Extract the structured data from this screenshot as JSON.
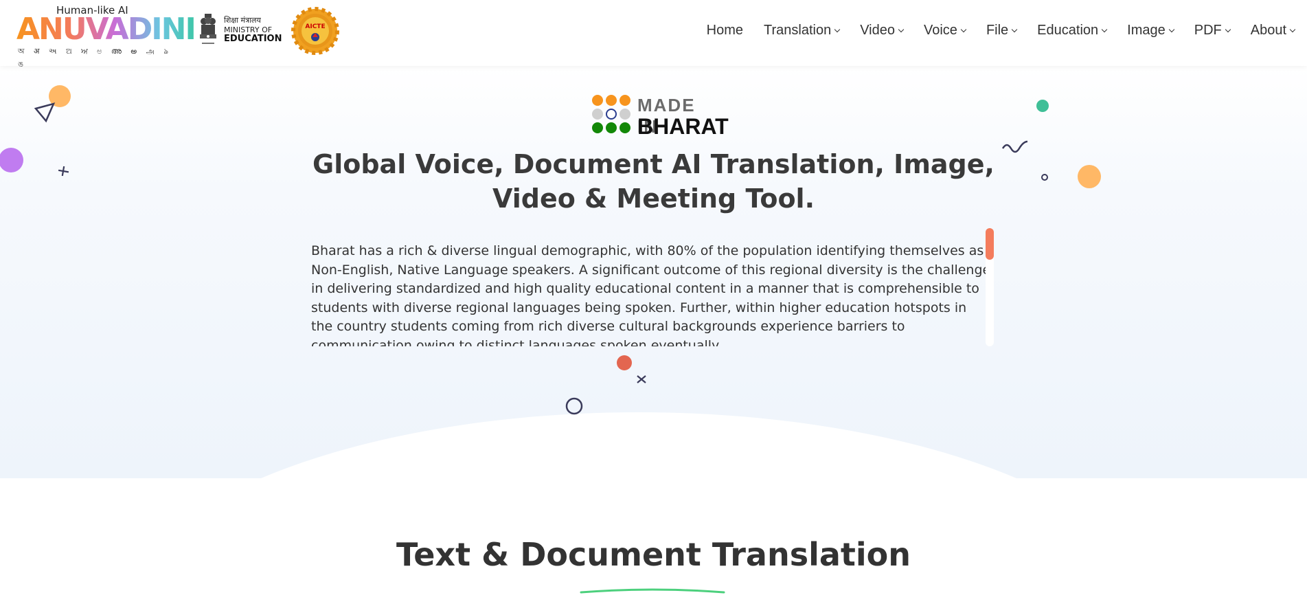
{
  "header": {
    "logo_tagline": "Human-like AI",
    "logo_name": "ANUVADINI",
    "logo_script": "অ अ અ ଅ ਅ ಅ അ అ அ ঌ ঙ",
    "ministry_hindi": "शिक्षा मंत्रालय",
    "ministry_line1": "MINISTRY OF",
    "ministry_line2": "EDUCATION",
    "aicte_label": "AICTE"
  },
  "nav": {
    "items": [
      {
        "label": "Home",
        "dropdown": false
      },
      {
        "label": "Translation",
        "dropdown": true
      },
      {
        "label": "Video",
        "dropdown": true
      },
      {
        "label": "Voice",
        "dropdown": true
      },
      {
        "label": "File",
        "dropdown": true
      },
      {
        "label": "Education",
        "dropdown": true
      },
      {
        "label": "Image",
        "dropdown": true
      },
      {
        "label": "PDF",
        "dropdown": true
      },
      {
        "label": "About",
        "dropdown": true
      }
    ]
  },
  "hero": {
    "badge_line1": "MADE IN",
    "badge_line2": "BHARAT",
    "title": "Global Voice, Document AI Translation, Image, Video & Meeting Tool.",
    "description": "Bharat has a rich & diverse lingual demographic, with 80% of the population identifying themselves as Non-English, Native Language speakers. A significant outcome of this regional diversity is the challenge in delivering standardized and high quality educational content in a manner that is comprehensible to students with diverse regional languages being spoken. Further, within higher education hotspots in the country students coming from rich diverse cultural backgrounds experience barriers to communication owing to distinct languages spoken eventually"
  },
  "section": {
    "title": "Text & Document Translation"
  },
  "colors": {
    "accent_orange": "#f47c5c",
    "underline_green": "#4cd07d",
    "text_dark": "#333333"
  }
}
